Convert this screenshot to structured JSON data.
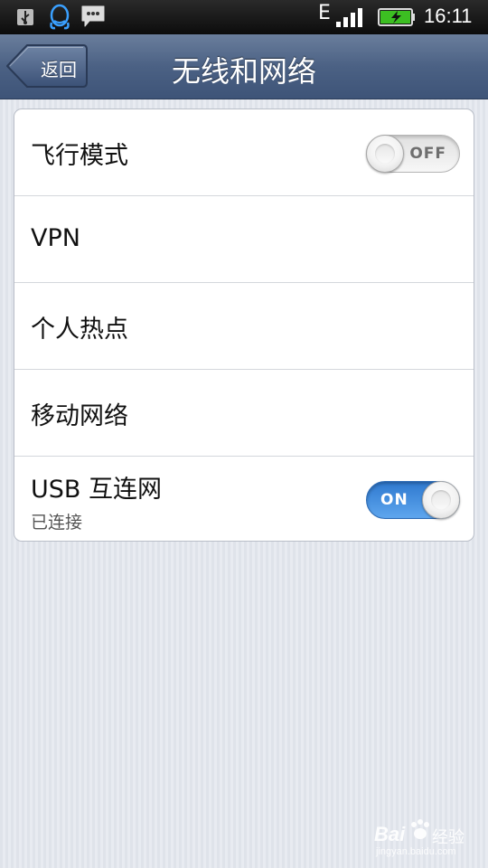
{
  "status_bar": {
    "network_type": "E",
    "time": "16:11",
    "icons": [
      "usb-icon",
      "qq-icon",
      "message-icon",
      "signal-icon",
      "battery-charging-icon"
    ]
  },
  "header": {
    "back_label": "返回",
    "title": "无线和网络"
  },
  "settings": {
    "items": [
      {
        "label": "飞行模式",
        "toggle": {
          "state": "off",
          "label": "OFF"
        }
      },
      {
        "label": "VPN"
      },
      {
        "label": "个人热点"
      },
      {
        "label": "移动网络"
      },
      {
        "label": "USB 互连网",
        "sublabel": "已连接",
        "toggle": {
          "state": "on",
          "label": "ON"
        }
      }
    ]
  },
  "watermark": {
    "brand": "Bai",
    "brand_suffix": "经验",
    "url": "jingyan.baidu.com"
  },
  "colors": {
    "title_bar": "#4b6184",
    "toggle_on": "#3f8be0",
    "toggle_off": "#ececec",
    "background": "#e4e7ed"
  }
}
